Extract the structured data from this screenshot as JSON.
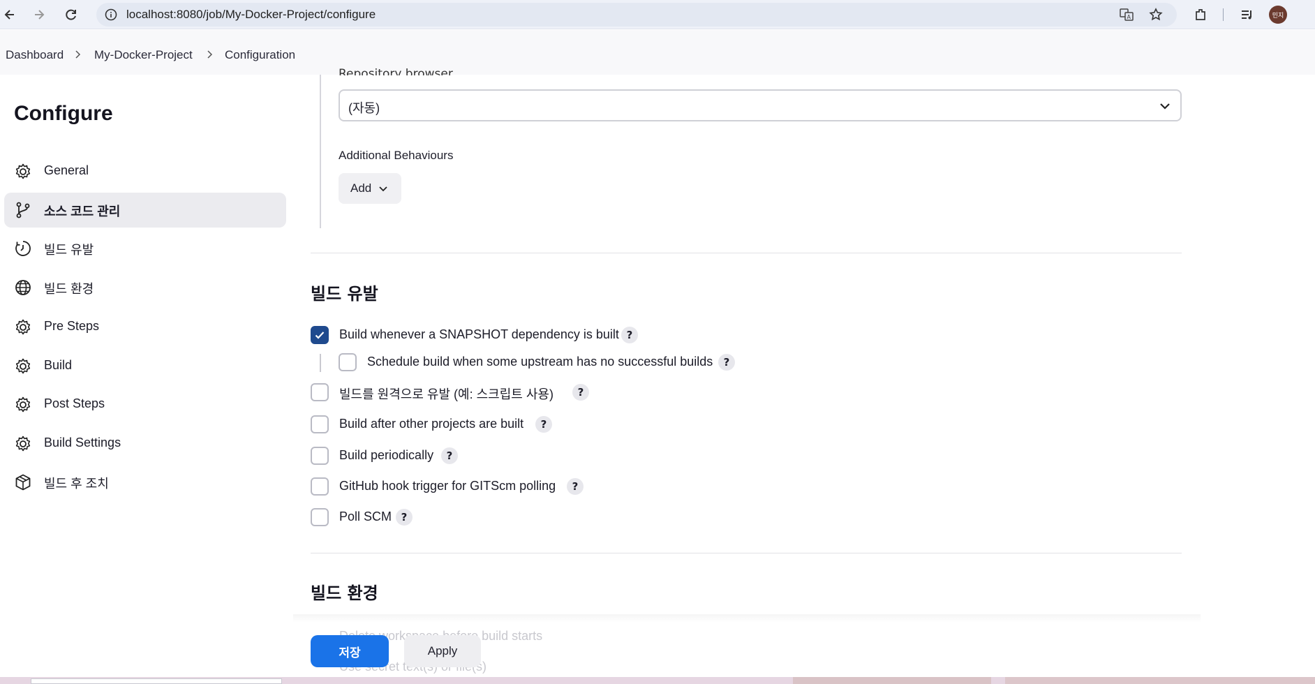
{
  "browser": {
    "url": "localhost:8080/job/My-Docker-Project/configure",
    "avatar_text": "민지"
  },
  "breadcrumb": {
    "items": [
      "Dashboard",
      "My-Docker-Project",
      "Configuration"
    ]
  },
  "sidebar": {
    "title": "Configure",
    "items": [
      {
        "label": "General",
        "icon": "gear-icon"
      },
      {
        "label": "소스 코드 관리",
        "icon": "git-branch-icon"
      },
      {
        "label": "빌드 유발",
        "icon": "timer-icon"
      },
      {
        "label": "빌드 환경",
        "icon": "globe-icon"
      },
      {
        "label": "Pre Steps",
        "icon": "gear-icon"
      },
      {
        "label": "Build",
        "icon": "gear-icon"
      },
      {
        "label": "Post Steps",
        "icon": "gear-icon"
      },
      {
        "label": "Build Settings",
        "icon": "gear-icon"
      },
      {
        "label": "빌드 후 조치",
        "icon": "package-icon"
      }
    ],
    "active_index": 1
  },
  "scm": {
    "repo_browser_label": "Repository browser",
    "repo_browser_value": "(자동)",
    "additional_behaviours_label": "Additional Behaviours",
    "add_button_label": "Add"
  },
  "build_triggers": {
    "title": "빌드 유발",
    "options": [
      {
        "label": "Build whenever a SNAPSHOT dependency is built",
        "checked": true
      },
      {
        "label": "Schedule build when some upstream has no successful builds",
        "checked": false
      },
      {
        "label": "빌드를 원격으로 유발 (예: 스크립트 사용)",
        "checked": false
      },
      {
        "label": "Build after other projects are built",
        "checked": false
      },
      {
        "label": "Build periodically",
        "checked": false
      },
      {
        "label": "GitHub hook trigger for GITScm polling",
        "checked": false
      },
      {
        "label": "Poll SCM",
        "checked": false
      }
    ],
    "help_label": "?"
  },
  "build_env": {
    "title": "빌드 환경",
    "first_option_partial": "Delete workspace before build starts",
    "second_option_partial": "Use secret text(s) or file(s)"
  },
  "footer": {
    "save_label": "저장",
    "apply_label": "Apply"
  },
  "colors": {
    "primary": "#1a73e8",
    "checked_box": "#1f4a8e",
    "active_sidebar_bg": "#ebebef"
  }
}
